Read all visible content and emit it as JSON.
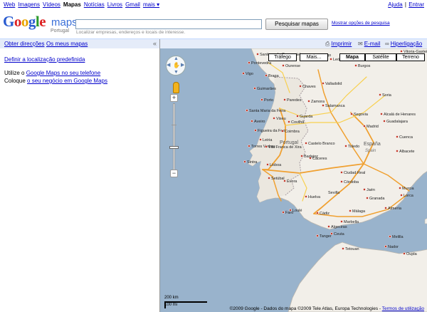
{
  "top_nav": {
    "items": [
      {
        "label": "Web",
        "current": false
      },
      {
        "label": "Imagens",
        "current": false
      },
      {
        "label": "Vídeos",
        "current": false
      },
      {
        "label": "Mapas",
        "current": true
      },
      {
        "label": "Notícias",
        "current": false
      },
      {
        "label": "Livros",
        "current": false
      },
      {
        "label": "Gmail",
        "current": false
      },
      {
        "label": "mais ▾",
        "current": false
      }
    ],
    "help": "Ajuda",
    "separator": "|",
    "signin": "Entrar"
  },
  "header": {
    "logo_google": "Google",
    "logo_maps": "maps",
    "logo_country": "Portugal",
    "search_value": "",
    "search_hint": "Localizar empresas, endereços e locais de interesse.",
    "search_button": "Pesquisar mapas",
    "search_options": "Mostrar opções de pesquisa"
  },
  "left_panel": {
    "tab_directions": "Obter direcções",
    "tab_mymaps": "Os meus mapas",
    "collapse": "«",
    "default_location": "Definir a localização predefinida",
    "line1_prefix": "Utilize o ",
    "line1_link": "Google Maps no seu telefone",
    "line2_prefix": "Coloque ",
    "line2_link": "o seu negócio em Google Maps"
  },
  "map_toolbar": {
    "print": "Imprimir",
    "email": "E-mail",
    "link": "Hiperligação"
  },
  "map_types": {
    "traffic": "Tráfego",
    "more": "Mais...",
    "map": "Mapa",
    "satellite": "Satélite",
    "terrain": "Terreno",
    "selected": "Mapa"
  },
  "zoom": {
    "plus": "+",
    "minus": "−"
  },
  "scale": {
    "km": "200 km",
    "mi": "100 mi"
  },
  "copyright": {
    "text": "©2009 Google - Dados do mapa ©2009 Tele Atlas, Europa Technologies - ",
    "terms": "Termos de utilização"
  },
  "cities": [
    {
      "name": "Santiago de Compostela"
    },
    {
      "name": "Lugo"
    },
    {
      "name": "Pontevedra"
    },
    {
      "name": "Ourense"
    },
    {
      "name": "Vigo"
    },
    {
      "name": "León"
    },
    {
      "name": "Burgos"
    },
    {
      "name": "Vitoria-Gasteiz"
    },
    {
      "name": "Braga"
    },
    {
      "name": "Chaves"
    },
    {
      "name": "Valladolid"
    },
    {
      "name": "Guimarães"
    },
    {
      "name": "Porto"
    },
    {
      "name": "Paredes"
    },
    {
      "name": "Zamora"
    },
    {
      "name": "Soria"
    },
    {
      "name": "Salamanca"
    },
    {
      "name": "Segovia"
    },
    {
      "name": "Guadalajara"
    },
    {
      "name": "Alcalá de Henares"
    },
    {
      "name": "Santa Maria da Feira"
    },
    {
      "name": "Aveiro"
    },
    {
      "name": "Viseu"
    },
    {
      "name": "Guarda"
    },
    {
      "name": "Covilhã"
    },
    {
      "name": "Madrid"
    },
    {
      "name": "Cuenca"
    },
    {
      "name": "Figueira da Foz"
    },
    {
      "name": "Coimbra"
    },
    {
      "name": "Castelo Branco"
    },
    {
      "name": "Toledo"
    },
    {
      "name": "Portugal"
    },
    {
      "name": "Leiria"
    },
    {
      "name": "Cáceres"
    },
    {
      "name": "España"
    },
    {
      "name": "Spain"
    },
    {
      "name": "Torres Vedras"
    },
    {
      "name": "Vila Franca de Xira"
    },
    {
      "name": "Badajoz"
    },
    {
      "name": "Albacete"
    },
    {
      "name": "Sintra"
    },
    {
      "name": "Lisboa"
    },
    {
      "name": "Setúbal"
    },
    {
      "name": "Évora"
    },
    {
      "name": "Ciudad Real"
    },
    {
      "name": "Córdoba"
    },
    {
      "name": "Jaén"
    },
    {
      "name": "Murcia"
    },
    {
      "name": "Huelva"
    },
    {
      "name": "Sevilla"
    },
    {
      "name": "Granada"
    },
    {
      "name": "Almería"
    },
    {
      "name": "Lorca"
    },
    {
      "name": "Faro"
    },
    {
      "name": "Loulé"
    },
    {
      "name": "Cádiz"
    },
    {
      "name": "Málaga"
    },
    {
      "name": "Marbella"
    },
    {
      "name": "Algeciras"
    },
    {
      "name": "Ceuta"
    },
    {
      "name": "Tanger"
    },
    {
      "name": "Tetouan"
    },
    {
      "name": "Melilla"
    },
    {
      "name": "Nador"
    },
    {
      "name": "Oujda"
    }
  ]
}
